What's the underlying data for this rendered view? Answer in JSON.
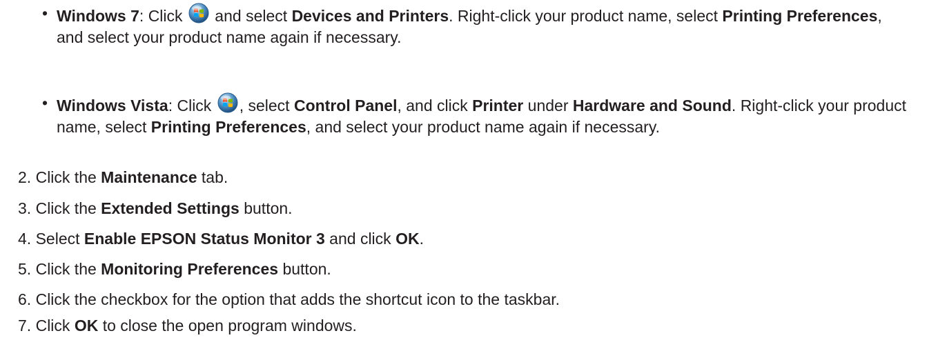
{
  "bullets": [
    {
      "marker": "•",
      "parts": [
        {
          "t": "Windows 7",
          "b": true
        },
        {
          "t": ": Click ",
          "b": false
        },
        {
          "icon": "windows-start-icon"
        },
        {
          "t": " and select ",
          "b": false
        },
        {
          "t": "Devices and Printers",
          "b": true
        },
        {
          "t": ". Right-click your product name, select ",
          "b": false
        },
        {
          "t": "Printing Preferences",
          "b": true
        },
        {
          "t": ", and select your product name again if necessary.",
          "b": false
        }
      ]
    },
    {
      "marker": "•",
      "parts": [
        {
          "t": "Windows Vista",
          "b": true
        },
        {
          "t": ": Click ",
          "b": false
        },
        {
          "icon": "windows-start-icon"
        },
        {
          "t": ", select ",
          "b": false
        },
        {
          "t": "Control Panel",
          "b": true
        },
        {
          "t": ", and click ",
          "b": false
        },
        {
          "t": "Printer",
          "b": true
        },
        {
          "t": " under ",
          "b": false
        },
        {
          "t": "Hardware and Sound",
          "b": true
        },
        {
          "t": ". Right-click your product name, select ",
          "b": false
        },
        {
          "t": "Printing Preferences",
          "b": true
        },
        {
          "t": ", and select your product name again if necessary.",
          "b": false
        }
      ]
    }
  ],
  "steps": [
    {
      "num": "2.",
      "parts": [
        {
          "t": "Click the ",
          "b": false
        },
        {
          "t": "Maintenance",
          "b": true
        },
        {
          "t": " tab.",
          "b": false
        }
      ]
    },
    {
      "num": "3.",
      "parts": [
        {
          "t": "Click the ",
          "b": false
        },
        {
          "t": "Extended Settings",
          "b": true
        },
        {
          "t": " button.",
          "b": false
        }
      ]
    },
    {
      "num": "4.",
      "parts": [
        {
          "t": "Select ",
          "b": false
        },
        {
          "t": "Enable EPSON Status Monitor 3",
          "b": true
        },
        {
          "t": " and click ",
          "b": false
        },
        {
          "t": "OK",
          "b": true
        },
        {
          "t": ".",
          "b": false
        }
      ]
    },
    {
      "num": "5.",
      "parts": [
        {
          "t": "Click the ",
          "b": false
        },
        {
          "t": "Monitoring Preferences",
          "b": true
        },
        {
          "t": " button.",
          "b": false
        }
      ]
    },
    {
      "num": "6.",
      "parts": [
        {
          "t": "Click the checkbox for the option that adds the shortcut icon to the taskbar.",
          "b": false
        }
      ]
    },
    {
      "num": "7.",
      "parts": [
        {
          "t": "Click ",
          "b": false
        },
        {
          "t": "OK",
          "b": true
        },
        {
          "t": " to close the open program windows.",
          "b": false
        }
      ]
    }
  ]
}
